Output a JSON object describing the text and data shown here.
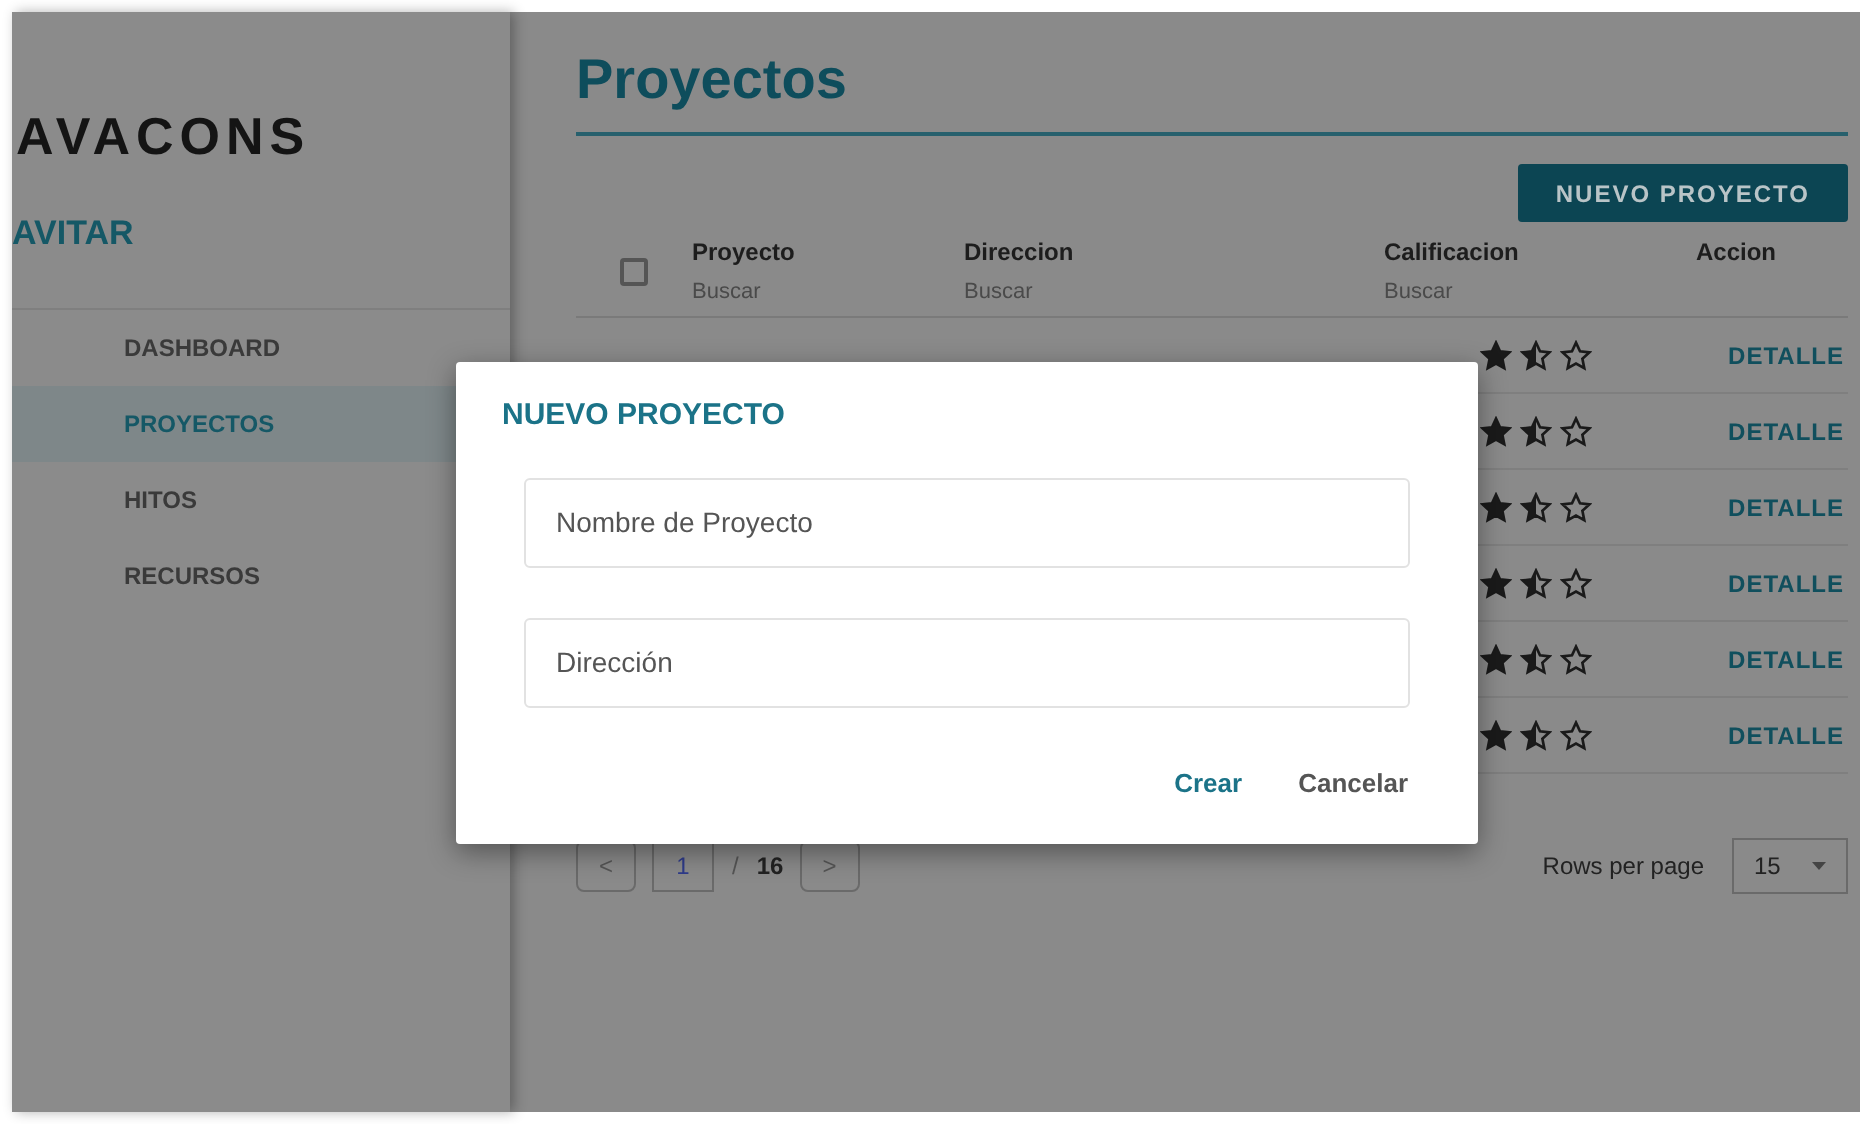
{
  "sidebar": {
    "brand": "AVACONS",
    "user": "AVITAR",
    "items": [
      {
        "label": "DASHBOARD",
        "selected": false
      },
      {
        "label": "PROYECTOS",
        "selected": true
      },
      {
        "label": "HITOS",
        "selected": false
      },
      {
        "label": "RECURSOS",
        "selected": false
      }
    ]
  },
  "page": {
    "title": "Proyectos",
    "new_button": "NUEVO PROYECTO"
  },
  "table": {
    "select_all": {
      "checked": false
    },
    "columns": [
      {
        "label": "Proyecto",
        "filter_placeholder": "Buscar"
      },
      {
        "label": "Direccion",
        "filter_placeholder": "Buscar"
      },
      {
        "label": "Calificacion",
        "filter_placeholder": "Buscar"
      },
      {
        "label": "Accion"
      }
    ],
    "rows": [
      {
        "stars": 1.5,
        "action": "DETALLE"
      },
      {
        "stars": 1.5,
        "action": "DETALLE"
      },
      {
        "stars": 1.5,
        "action": "DETALLE"
      },
      {
        "stars": 1.5,
        "action": "DETALLE"
      },
      {
        "stars": 1.5,
        "action": "DETALLE"
      },
      {
        "stars": 1.5,
        "action": "DETALLE"
      }
    ]
  },
  "pagination": {
    "prev": "<",
    "page": "1",
    "separator": "/",
    "total": "16",
    "next": ">",
    "rows_label": "Rows per page",
    "rows_value": "15"
  },
  "dialog": {
    "title": "NUEVO PROYECTO",
    "fields": [
      {
        "placeholder": "Nombre de Proyecto"
      },
      {
        "placeholder": "Dirección"
      }
    ],
    "buttons": [
      {
        "label": "Crear",
        "kind": "primary"
      },
      {
        "label": "Cancelar",
        "kind": "secondary"
      }
    ]
  }
}
